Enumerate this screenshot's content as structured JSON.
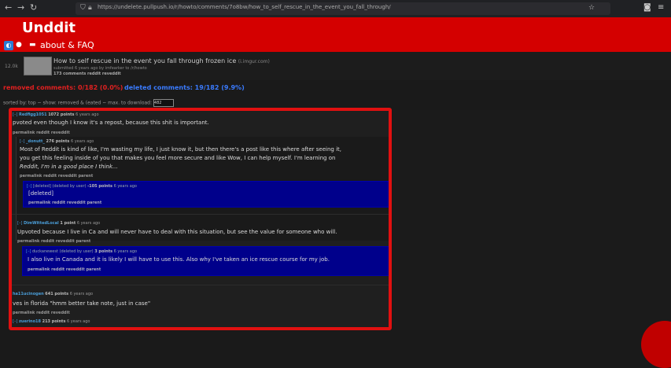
{
  "browser": {
    "url": "https://undelete.pullpush.io/r/howto/comments/7o8bw/how_to_self_rescue_in_the_event_you_fall_through/"
  },
  "site": {
    "logo": "Unddit",
    "about_link": "about & FAQ"
  },
  "post": {
    "score": "12.0k",
    "title": "How to self rescue in the event you fall through frozen ice",
    "domain": "(i.imgur.com)",
    "submitted": "submitted 6 years ago by imfearker to /r/howto",
    "links": "173 comments  reddit  reveddit"
  },
  "stats": {
    "removed": "removed comments: 0/182 (0.0%)",
    "deleted": "deleted comments: 19/182 (9.9%)"
  },
  "sort": {
    "label": "sorted by: top   ~   show: removed & (eated ~  max. to download:",
    "max_value": "482"
  },
  "comments": [
    {
      "toggle": "[–]",
      "author": "Redfigg1051",
      "points": "1072 points",
      "age": "6 years ago",
      "body": "pvoted even though I know it's a repost, because this shit is important.",
      "links": "permalink  reddit  reveddit",
      "child": {
        "toggle": "[–]",
        "author": "_donutt_",
        "points": "276 points",
        "age": "6 years ago",
        "body_lines": [
          "Most of Reddit is kind of like, I'm wasting my life, I just know it, but then there's a post like this where after seeing it,",
          "you get this feeling inside of you that makes you feel more secure and like Wow, I can help myself. I'm learning on",
          "Reddit, I'm in a good place I think..."
        ],
        "links": "permalink  reddit  reveddit  parent",
        "child": {
          "toggle": "[–]",
          "author": "[deleted]",
          "status": "(deleted by user)",
          "points": "-105 points",
          "age": "6 years ago",
          "body": "[deleted]",
          "links": "permalink  reddit  reveddit  parent"
        }
      }
    },
    {
      "toggle": "[–]",
      "author": "DimWittedLocal",
      "points": "1 point",
      "age": "6 years ago",
      "body": "Upvoted because I live in Ca and will never have to deal with this situation, but see the value for someone who will.",
      "links": "permalink  reddit  reveddit  parent",
      "child": {
        "toggle": "[–]",
        "author": "duckanewest",
        "status": "(deleted by user)",
        "points": "3 points",
        "age": "6 years ago",
        "body": "I also live in Canada and it is likely I will have to use this. Also why I've taken an ice rescue course for my job.",
        "links": "permalink  reddit  reveddit  parent"
      }
    },
    {
      "toggle": "",
      "author": "ha11ucinogen",
      "points": "641 points",
      "age": "6 years ago",
      "body": "ves in florida \"hmm better take note, just in case\"",
      "links": "permalink  reddit  reveddit"
    },
    {
      "toggle": "[–]",
      "author": "zuerino18",
      "points": "213 points",
      "age": "6 years ago",
      "body": "",
      "links": ""
    }
  ],
  "colors": {
    "header_red": "#d40000",
    "highlight_frame": "#e01010",
    "deleted_blue": "#00008b",
    "author_link": "#4a9cd6"
  }
}
